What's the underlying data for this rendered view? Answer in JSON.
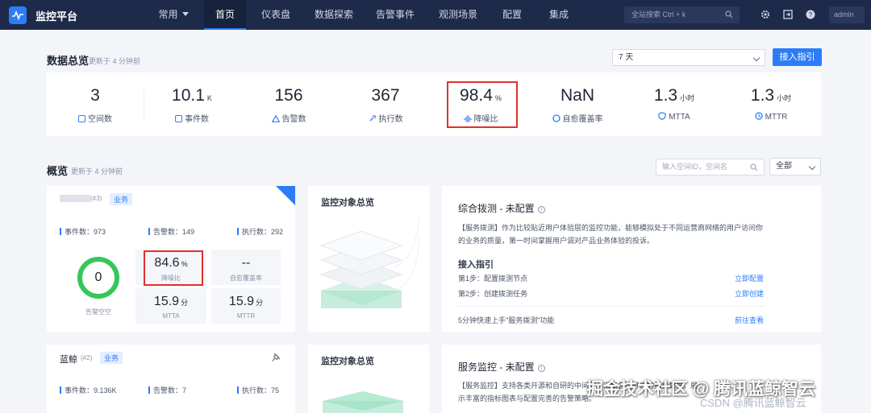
{
  "app": {
    "title": "监控平台"
  },
  "nav": {
    "items": [
      {
        "label": "常用"
      },
      {
        "label": "首页"
      },
      {
        "label": "仪表盘"
      },
      {
        "label": "数据探索"
      },
      {
        "label": "告警事件"
      },
      {
        "label": "观测场景"
      },
      {
        "label": "配置"
      },
      {
        "label": "集成"
      }
    ],
    "search_placeholder": "全站搜索 Ctrl + k",
    "user": "admin"
  },
  "summary": {
    "title": "数据总览",
    "updated": "更新于 4 分钟前",
    "range_select": "7 天",
    "guide_button": "接入指引",
    "stats": [
      {
        "value": "3",
        "unit": "",
        "label": "空间数"
      },
      {
        "value": "10.1",
        "unit": "K",
        "label": "事件数"
      },
      {
        "value": "156",
        "unit": "",
        "label": "告警数"
      },
      {
        "value": "367",
        "unit": "",
        "label": "执行数"
      },
      {
        "value": "98.4",
        "unit": "%",
        "label": "降噪比"
      },
      {
        "value": "NaN",
        "unit": "",
        "label": "自愈覆盖率"
      },
      {
        "value": "1.3",
        "unit": "小时",
        "label": "MTTA"
      },
      {
        "value": "1.3",
        "unit": "小时",
        "label": "MTTR"
      }
    ]
  },
  "overview": {
    "title": "概览",
    "updated": "更新于 4 分钟前",
    "search_placeholder": "输入空间ID，空间名",
    "filter_select": "全部",
    "cards": [
      {
        "space_id": "(#3)",
        "tag": "业务",
        "metrics": [
          "事件数：973",
          "告警数：149",
          "执行数：292"
        ],
        "ring_value": "0",
        "ring_label": "告警空空",
        "noise_value": "84.6",
        "noise_unit": "%",
        "noise_label": "降噪比",
        "heal_value": "--",
        "heal_label": "自愈覆盖率",
        "mtta_value": "15.9",
        "mtta_unit": "分",
        "mtta_label": "MTTA",
        "mttr_value": "15.9",
        "mttr_unit": "分",
        "mttr_label": "MTTR",
        "panel_title": "监控对象总览",
        "right_title": "综合拨测 - 未配置",
        "desc": "【服务拨测】作为比较贴近用户体验层的监控功能，能够模拟处于不同运营商网络的用户访问你的业务的质量，第一时间掌握用户调对产品业务体验的投诉。",
        "guide_title": "接入指引",
        "steps": [
          {
            "text": "第1步：配置拨测节点",
            "link": "立即配置"
          },
          {
            "text": "第2步：创建拨测任务",
            "link": "立即创建"
          }
        ],
        "footer": "5分钟快速上手\"服务拨测\"功能",
        "footer_link": "前往查看"
      },
      {
        "name": "蓝鲸",
        "space_id": "(#2)",
        "tag": "业务",
        "metrics": [
          "事件数：9.136K",
          "告警数：7",
          "执行数：75"
        ],
        "panel_title": "监控对象总览",
        "right_title": "服务监控 - 未配置",
        "desc": "【服务监控】支持各类开源和自研的中间件，采集各类开发的指标数据，展示丰富的指标图表与配置完善的告警策略。"
      }
    ]
  },
  "watermark": "掘金技术社区 @ 腾讯蓝鲸智云",
  "watermark_sub": "CSDN @腾讯蓝鲸智云",
  "colors": {
    "nav_bg": "#1e2a4a",
    "primary": "#2d7cf7",
    "highlight": "#e0312b",
    "ring": "#34c759"
  }
}
